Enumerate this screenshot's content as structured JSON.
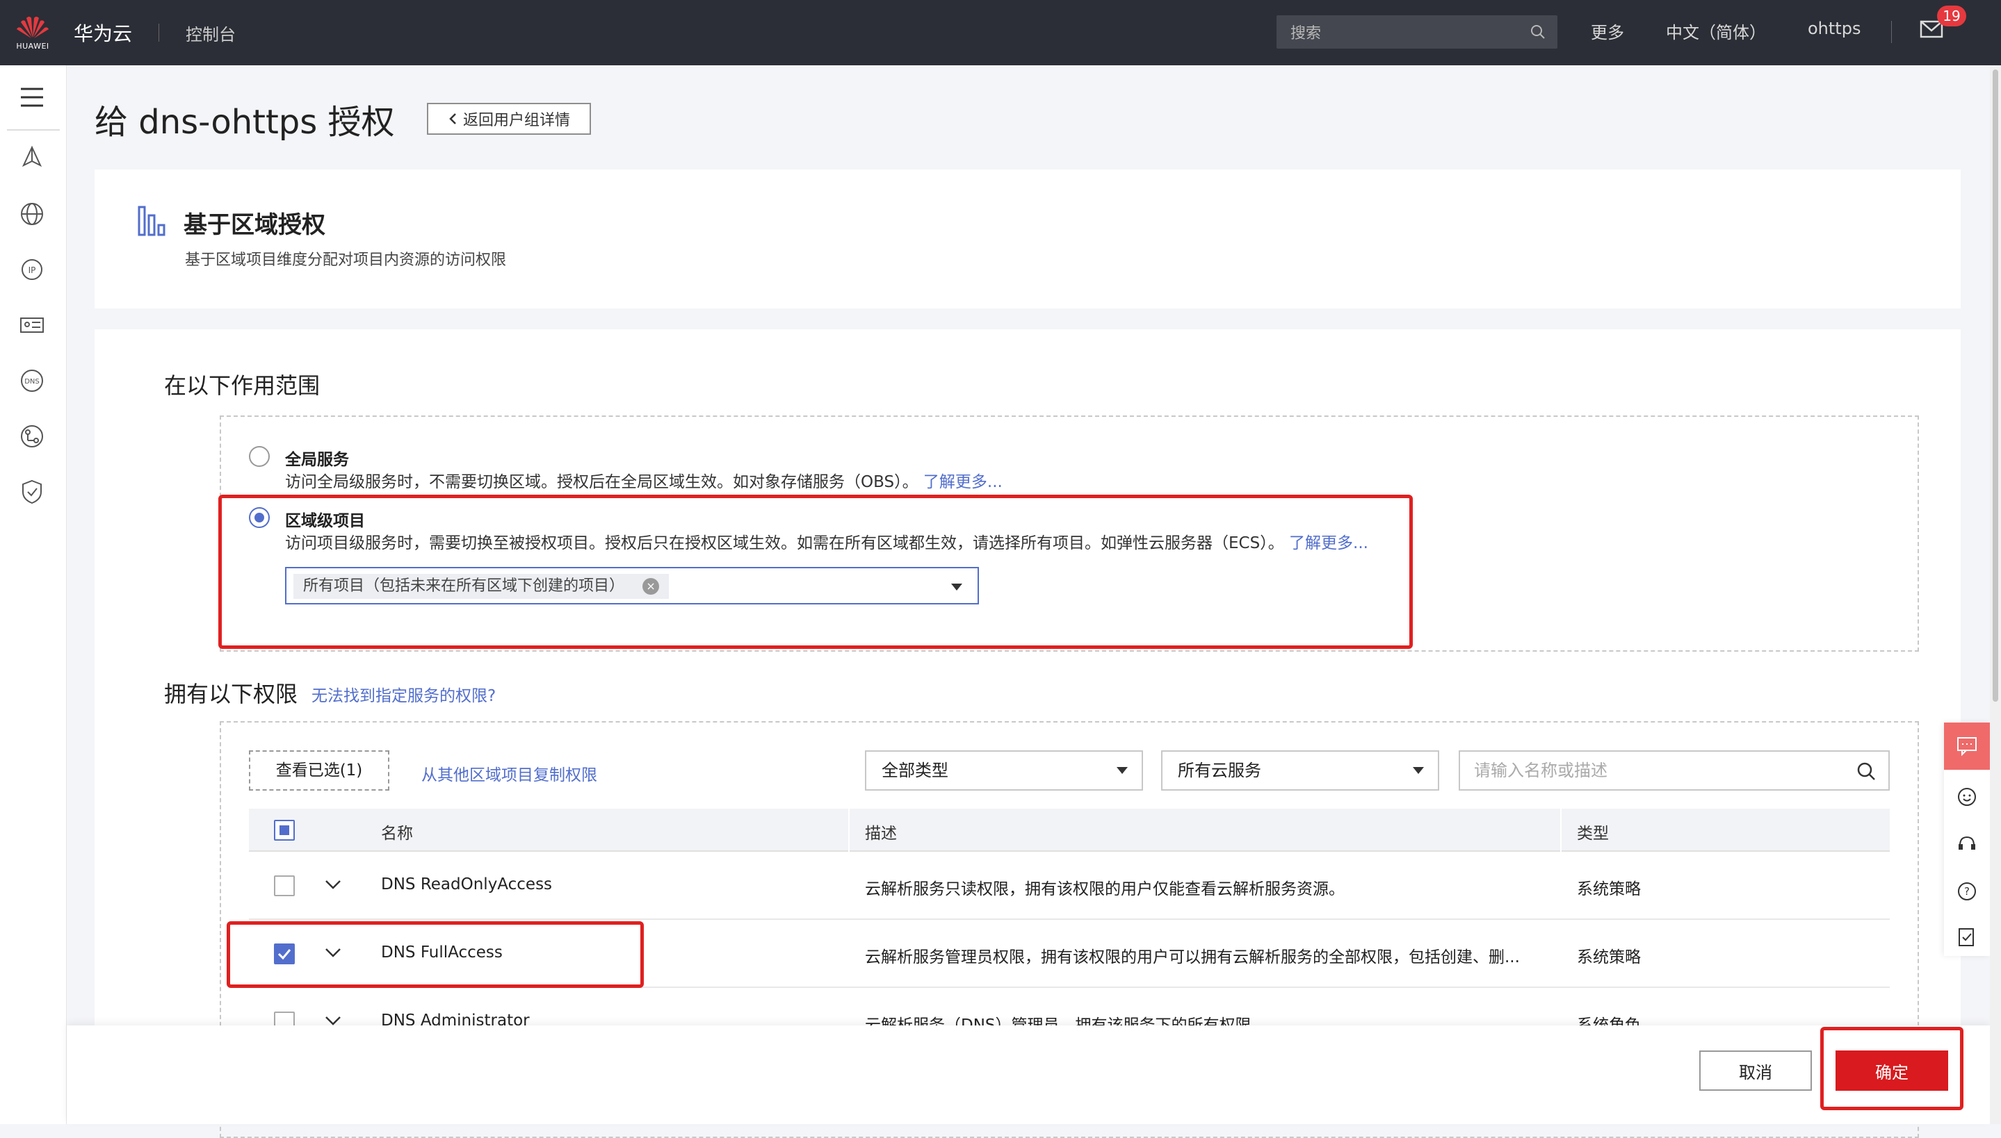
{
  "topbar": {
    "logo_text": "HUAWEI",
    "brand": "华为云",
    "console": "控制台",
    "search_placeholder": "搜索",
    "more": "更多",
    "language": "中文（简体）",
    "user": "ohttps",
    "mail_badge": "19"
  },
  "sidebar": {
    "icons": [
      "menu-icon",
      "cdn-icon",
      "globe-icon",
      "ip-icon",
      "identity-card-icon",
      "dns-icon",
      "network-icon",
      "shield-icon"
    ]
  },
  "page": {
    "title": "给 dns-ohttps 授权",
    "back_button": "返回用户组详情"
  },
  "region_card": {
    "title": "基于区域授权",
    "subtitle": "基于区域项目维度分配对项目内资源的访问权限"
  },
  "scope": {
    "heading": "在以下作用范围",
    "global": {
      "title": "全局服务",
      "desc": "访问全局级服务时，不需要切换区域。授权后在全局区域生效。如对象存储服务（OBS）。",
      "link": "了解更多...",
      "selected": false
    },
    "regional": {
      "title": "区域级项目",
      "desc": "访问项目级服务时，需要切换至被授权项目。授权后只在授权区域生效。如需在所有区域都生效，请选择所有项目。如弹性云服务器（ECS）。",
      "link": "了解更多...",
      "selected": true
    },
    "selected_project": "所有项目（包括未来在所有区域下创建的项目）"
  },
  "permissions": {
    "heading": "拥有以下权限",
    "help_link": "无法找到指定服务的权限?",
    "view_selected": "查看已选(1)",
    "copy_link": "从其他区域项目复制权限",
    "type_filter": "全部类型",
    "service_filter": "所有云服务",
    "search_placeholder": "请输入名称或描述",
    "columns": {
      "name": "名称",
      "desc": "描述",
      "type": "类型"
    },
    "rows": [
      {
        "name": "DNS ReadOnlyAccess",
        "desc": "云解析服务只读权限，拥有该权限的用户仅能查看云解析服务资源。",
        "type": "系统策略",
        "checked": false
      },
      {
        "name": "DNS FullAccess",
        "desc": "云解析服务管理员权限，拥有该权限的用户可以拥有云解析服务的全部权限，包括创建、删...",
        "type": "系统策略",
        "checked": true
      },
      {
        "name": "DNS Administrator",
        "desc": "云解析服务（DNS）管理员，拥有该服务下的所有权限",
        "type": "系统角色",
        "checked": false
      }
    ]
  },
  "footer": {
    "cancel": "取消",
    "confirm": "确定"
  },
  "colors": {
    "topbar": "#2b2e36",
    "accent_blue": "#526ecc",
    "confirm_red": "#d91a1e",
    "highlight_red": "#e02020"
  }
}
